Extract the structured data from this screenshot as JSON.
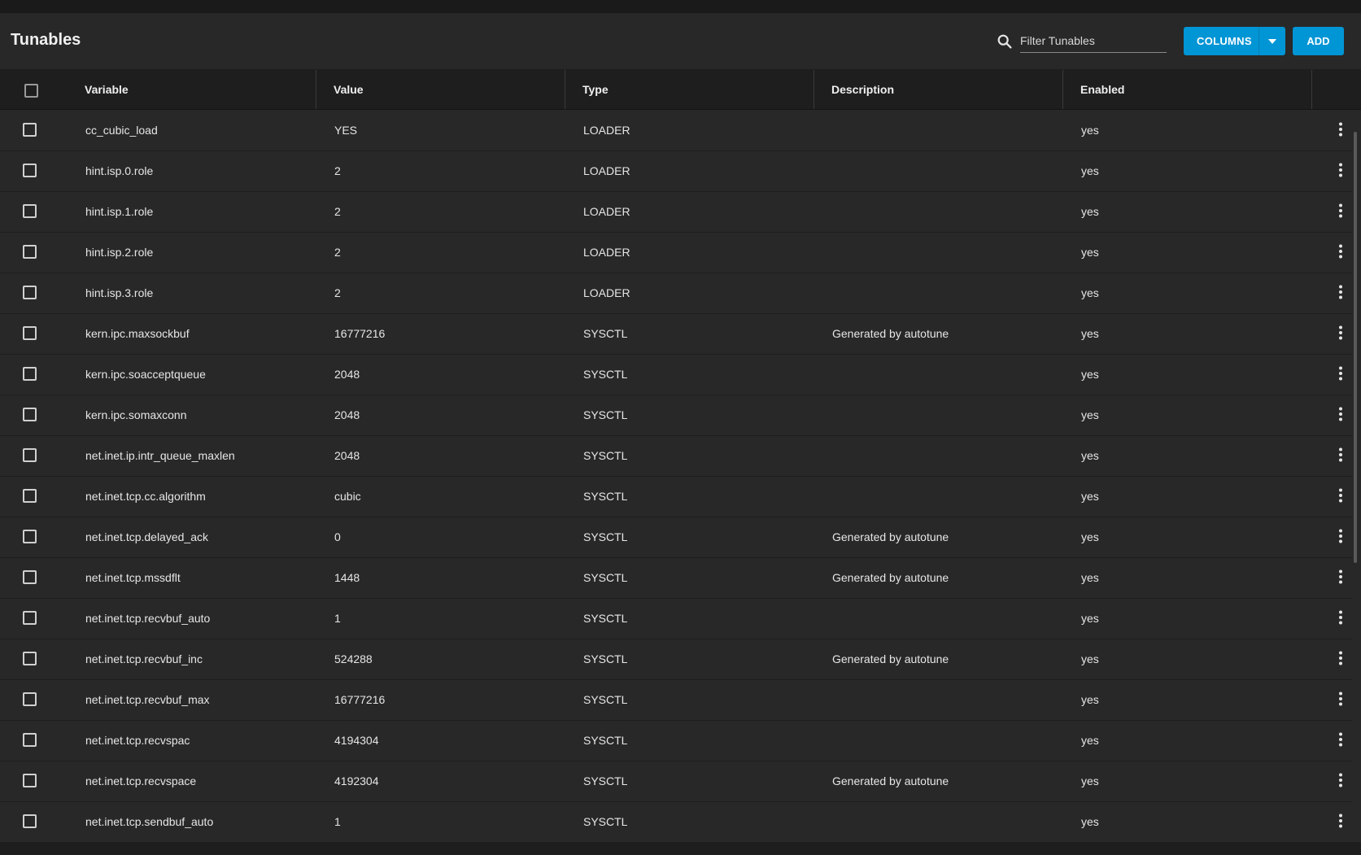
{
  "header": {
    "title": "Tunables",
    "search_placeholder": "Filter Tunables",
    "columns_label": "COLUMNS",
    "add_label": "ADD"
  },
  "table": {
    "columns": [
      "Variable",
      "Value",
      "Type",
      "Description",
      "Enabled"
    ],
    "rows": [
      {
        "variable": "cc_cubic_load",
        "value": "YES",
        "type": "LOADER",
        "description": "",
        "enabled": "yes"
      },
      {
        "variable": "hint.isp.0.role",
        "value": "2",
        "type": "LOADER",
        "description": "",
        "enabled": "yes"
      },
      {
        "variable": "hint.isp.1.role",
        "value": "2",
        "type": "LOADER",
        "description": "",
        "enabled": "yes"
      },
      {
        "variable": "hint.isp.2.role",
        "value": "2",
        "type": "LOADER",
        "description": "",
        "enabled": "yes"
      },
      {
        "variable": "hint.isp.3.role",
        "value": "2",
        "type": "LOADER",
        "description": "",
        "enabled": "yes"
      },
      {
        "variable": "kern.ipc.maxsockbuf",
        "value": "16777216",
        "type": "SYSCTL",
        "description": "Generated by autotune",
        "enabled": "yes"
      },
      {
        "variable": "kern.ipc.soacceptqueue",
        "value": "2048",
        "type": "SYSCTL",
        "description": "",
        "enabled": "yes"
      },
      {
        "variable": "kern.ipc.somaxconn",
        "value": "2048",
        "type": "SYSCTL",
        "description": "",
        "enabled": "yes"
      },
      {
        "variable": "net.inet.ip.intr_queue_maxlen",
        "value": "2048",
        "type": "SYSCTL",
        "description": "",
        "enabled": "yes"
      },
      {
        "variable": "net.inet.tcp.cc.algorithm",
        "value": "cubic",
        "type": "SYSCTL",
        "description": "",
        "enabled": "yes"
      },
      {
        "variable": "net.inet.tcp.delayed_ack",
        "value": "0",
        "type": "SYSCTL",
        "description": "Generated by autotune",
        "enabled": "yes"
      },
      {
        "variable": "net.inet.tcp.mssdflt",
        "value": "1448",
        "type": "SYSCTL",
        "description": "Generated by autotune",
        "enabled": "yes"
      },
      {
        "variable": "net.inet.tcp.recvbuf_auto",
        "value": "1",
        "type": "SYSCTL",
        "description": "",
        "enabled": "yes"
      },
      {
        "variable": "net.inet.tcp.recvbuf_inc",
        "value": "524288",
        "type": "SYSCTL",
        "description": "Generated by autotune",
        "enabled": "yes"
      },
      {
        "variable": "net.inet.tcp.recvbuf_max",
        "value": "16777216",
        "type": "SYSCTL",
        "description": "",
        "enabled": "yes"
      },
      {
        "variable": "net.inet.tcp.recvspac",
        "value": "4194304",
        "type": "SYSCTL",
        "description": "",
        "enabled": "yes"
      },
      {
        "variable": "net.inet.tcp.recvspace",
        "value": "4192304",
        "type": "SYSCTL",
        "description": "Generated by autotune",
        "enabled": "yes"
      },
      {
        "variable": "net.inet.tcp.sendbuf_auto",
        "value": "1",
        "type": "SYSCTL",
        "description": "",
        "enabled": "yes"
      }
    ]
  },
  "icons": {
    "search": "search-icon",
    "columns_dropdown": "caret-down-icon",
    "row_menu": "more-vertical-icon"
  },
  "colors": {
    "accent": "#0095d5",
    "background": "#282828",
    "header_background": "#1e1e1e",
    "text": "#e6e6e6"
  }
}
